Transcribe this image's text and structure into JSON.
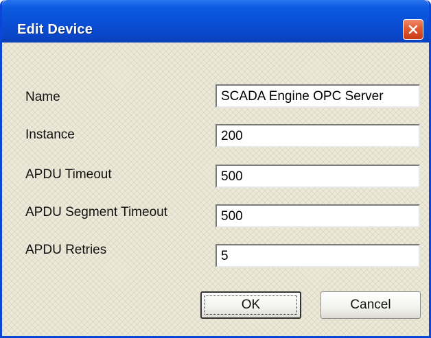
{
  "window": {
    "title": "Edit Device",
    "close_icon": "close-icon"
  },
  "fields": [
    {
      "label": "Name",
      "value": "SCADA Engine OPC Server"
    },
    {
      "label": "Instance",
      "value": "200"
    },
    {
      "label": "APDU Timeout",
      "value": "500"
    },
    {
      "label": "APDU Segment Timeout",
      "value": "500"
    },
    {
      "label": "APDU Retries",
      "value": "5"
    }
  ],
  "buttons": {
    "ok_label": "OK",
    "cancel_label": "Cancel"
  },
  "colors": {
    "titlebar": "#0a4fd6",
    "close_button": "#e05a30",
    "dialog_background": "#ece9d8"
  }
}
